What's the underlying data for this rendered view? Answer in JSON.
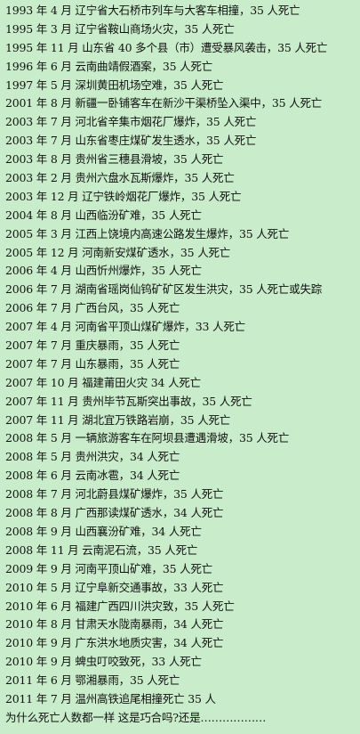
{
  "entries": [
    "1993 年 4 月  辽宁省大石桥市列车与大客车相撞，35 人死亡",
    "1995 年 3 月  辽宁省鞍山商场火灾，35 人死亡",
    "1995 年 11 月  山东省 40 多个县（市）遭受暴风袭击，35 人死亡",
    "1996 年 6 月  云南曲靖假酒案，35 人死亡",
    "1997 年 5 月  深圳黄田机场空难，35 人死亡",
    "2001 年 8 月  新疆一卧铺客车在新沙干渠桥坠入渠中，35 人死亡",
    "2003 年 7 月  河北省辛集市烟花厂爆炸，35 人死亡",
    "2003 年 7 月  山东省枣庄煤矿发生透水，35 人死亡",
    "2003 年 8 月  贵州省三穗县滑坡，35 人死亡",
    "2003 年 2 月  贵州六盘水瓦斯爆炸，35 人死亡",
    "2003 年 12 月  辽宁铁岭烟花厂爆炸，35 人死亡",
    "2004 年 8 月  山西临汾矿难，35 人死亡",
    "2005 年 3 月  江西上饶境内高速公路发生爆炸，35 人死亡",
    "2005 年 12 月  河南新安煤矿透水，35 人死亡",
    "2006 年 4 月  山西忻州爆炸，35 人死亡",
    "2006 年 7 月  湖南省瑶岗仙钨矿矿区发生洪灾，35 人死亡或失踪",
    "2006 年 7 月  广西台风，35 人死亡",
    "2007 年 4 月  河南省平顶山煤矿爆炸，33 人死亡",
    "2007 年 7 月  重庆暴雨，35 人死亡",
    "2007 年 7 月  山东暴雨，35 人死亡",
    "2007 年 10 月  福建莆田火灾  34 人死亡",
    "2007 年 11 月  贵州毕节瓦斯突出事故，35 人死亡",
    "2007 年 11 月  湖北宜万铁路岩崩，35 人死亡",
    "2008 年 5 月  一辆旅游客车在阿坝县遭遇滑坡，35 人死亡",
    "2008 年 5 月  贵州洪灾，34 人死亡",
    "2008 年 6 月  云南冰雹，34 人死亡",
    "2008 年 7 月  河北蔚县煤矿爆炸，35 人死亡",
    "2008 年 8 月  广西那读煤矿透水，34 人死亡",
    "2008 年 9 月  山西襄汾矿难，34 人死亡",
    "2008 年 11 月  云南泥石流，35 人死亡",
    "2009 年 9 月  河南平顶山矿难，35 人死亡",
    "2010 年 5 月  辽宁阜新交通事故，33 人死亡",
    "2010 年 6 月  福建广西四川洪灾致，35 人死亡",
    "2010 年 8 月  甘肃天水陇南暴雨，34 人死亡",
    "2010 年 9 月  广东洪水地质灾害，34 人死亡",
    "2010 年 9 月  蜱虫叮咬致死，33 人死亡",
    "2011 年 6 月  鄂湘暴雨，35 人死亡",
    "2011 年 7 月  温州高铁追尾相撞死亡 35 人"
  ],
  "closing": "为什么死亡人数都一样 这是巧合吗?还是………………"
}
